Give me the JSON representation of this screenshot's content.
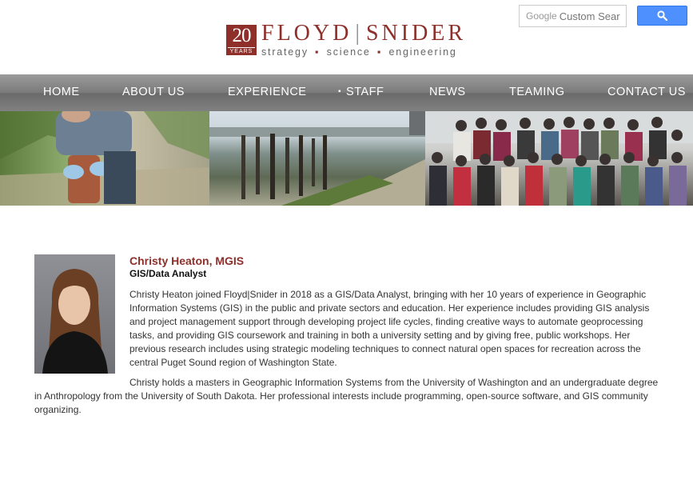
{
  "logo": {
    "badge_number": "20",
    "badge_label": "YEARS",
    "name_left": "FLOYD",
    "name_divider": "|",
    "name_right": "SNIDER",
    "tagline_1": "strategy",
    "tagline_2": "science",
    "tagline_3": "engineering",
    "tagline_sep": "▪"
  },
  "search": {
    "brand": "Google",
    "placeholder": "Custom Sear"
  },
  "nav": {
    "items": [
      {
        "label": "HOME"
      },
      {
        "label": "ABOUT US"
      },
      {
        "label": "EXPERIENCE"
      },
      {
        "label": "STAFF",
        "bullet": "▪"
      },
      {
        "label": "NEWS"
      },
      {
        "label": "TEAMING"
      },
      {
        "label": "CONTACT US"
      }
    ]
  },
  "profile": {
    "name": "Christy Heaton, MGIS",
    "title": "GIS/Data Analyst",
    "bio_paragraph_1": "Christy Heaton joined Floyd|Snider in 2018 as a GIS/Data Analyst, bringing with her 10 years of experience in Geographic Information Systems (GIS) in the public and private sectors and education. Her experience includes providing GIS analysis and project management support through developing project life cycles, finding creative ways to automate geoprocessing tasks, and providing GIS coursework and training in both a university setting and by giving free, public workshops. Her previous research includes using strategic modeling techniques to connect natural open spaces for recreation across the central Puget Sound region of Washington State.",
    "bio_paragraph_2": "Christy holds a masters in Geographic Information Systems from the University of Washington and an undergraduate degree in Anthropology from the University of South Dakota. Her professional interests include programming, open-source software, and GIS community organizing."
  },
  "colors": {
    "brand": "#8e2f2a",
    "search_button": "#4d90fe"
  },
  "icons": {
    "search_button": "search-icon"
  }
}
